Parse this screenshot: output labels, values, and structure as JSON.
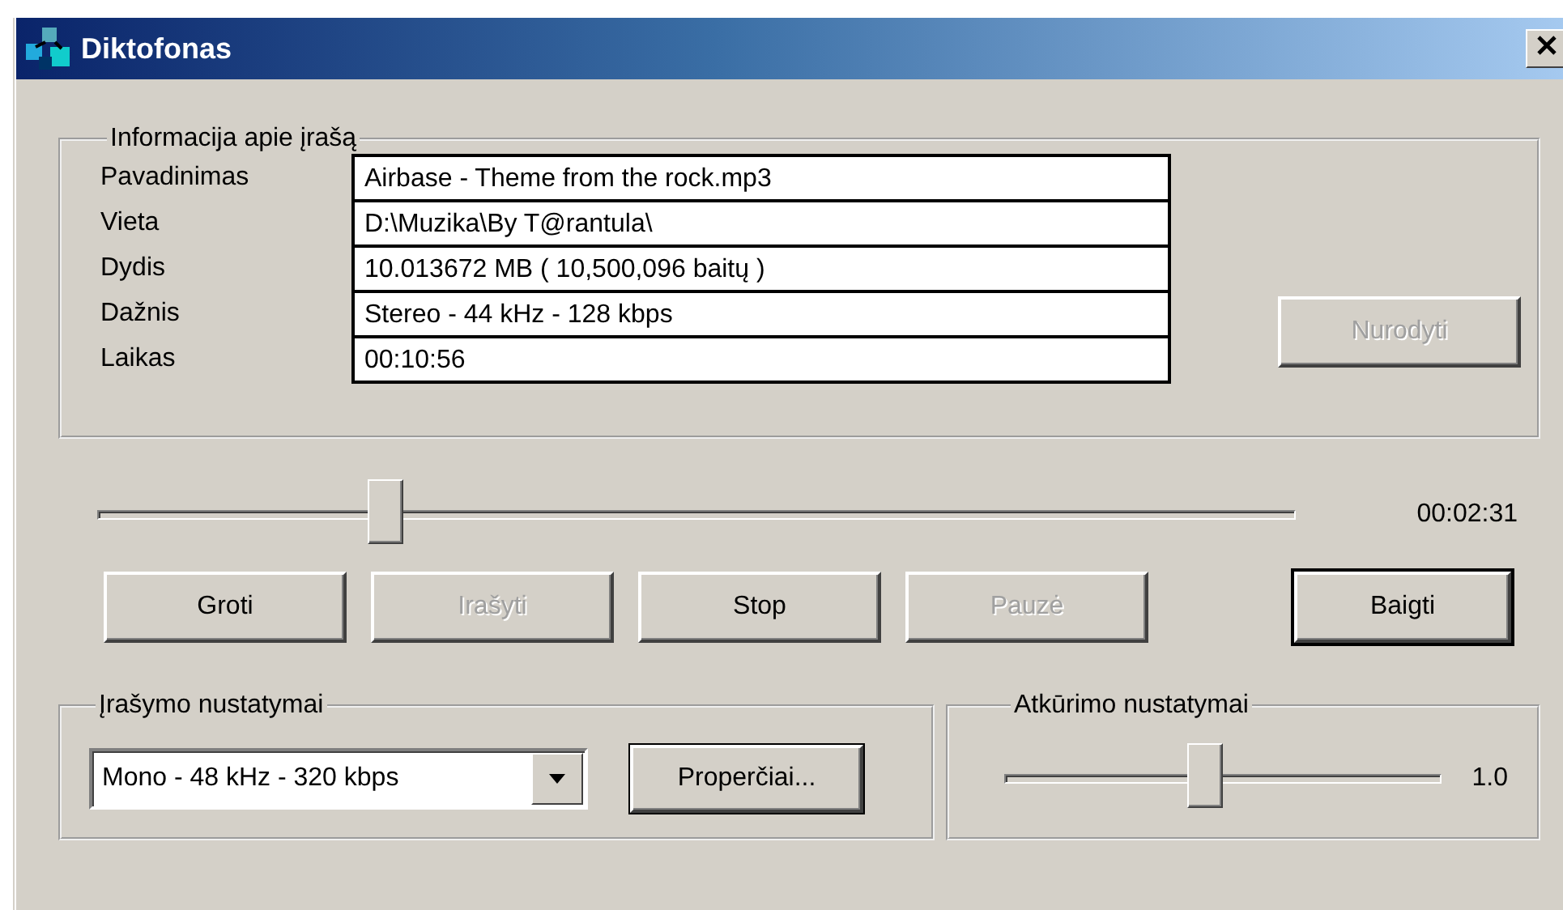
{
  "window": {
    "title": "Diktofonas"
  },
  "info_group": {
    "title": "Informacija apie įrašą",
    "fields": [
      {
        "label": "Pavadinimas",
        "value": "Airbase - Theme from the rock.mp3"
      },
      {
        "label": "Vieta",
        "value": "D:\\Muzika\\By T@rantula\\"
      },
      {
        "label": "Dydis",
        "value": "10.013672 MB ( 10,500,096 baitų )"
      },
      {
        "label": "Dažnis",
        "value": "Stereo - 44 kHz - 128 kbps"
      },
      {
        "label": "Laikas",
        "value": "00:10:56"
      }
    ],
    "button": {
      "label": "Nurodyti",
      "disabled": true
    }
  },
  "position": {
    "level": 0.24,
    "time": "00:02:31"
  },
  "buttons": [
    {
      "label": "Groti",
      "disabled": false,
      "default": false
    },
    {
      "label": "Irašyti",
      "disabled": true,
      "default": false
    },
    {
      "label": "Stop",
      "disabled": false,
      "default": false
    },
    {
      "label": "Pauzė",
      "disabled": true,
      "default": false
    },
    {
      "label": "Baigti",
      "disabled": false,
      "default": true
    }
  ],
  "recording_group": {
    "title": "Įrašymo nustatymai",
    "format": "Mono - 48 kHz - 320 kbps",
    "button": {
      "label": "Properčiai...",
      "disabled": false
    }
  },
  "playback_group": {
    "title": "Atkūrimo nustatymai",
    "level": 0.46,
    "value": "1.0"
  }
}
